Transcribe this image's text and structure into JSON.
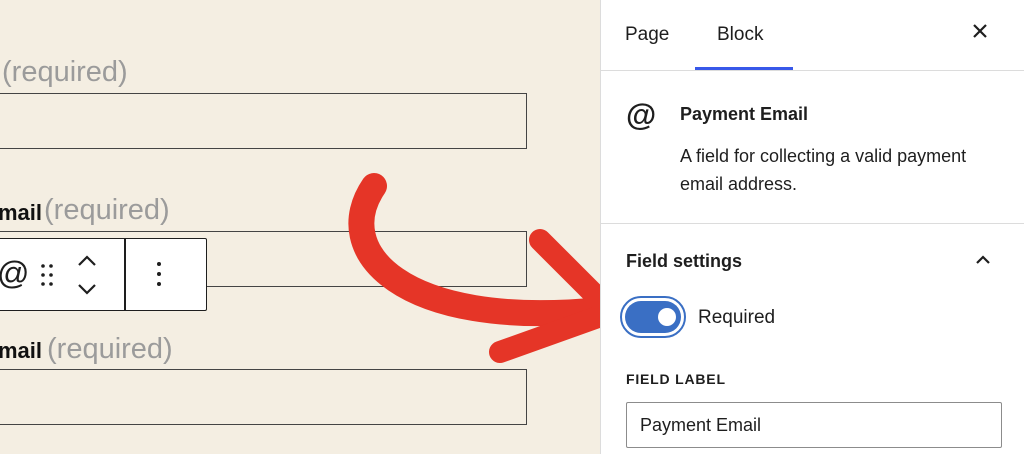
{
  "canvas": {
    "fields": [
      {
        "label": "",
        "required_text": "(required)"
      },
      {
        "label": "mail",
        "required_text": "(required)"
      },
      {
        "label": "mail",
        "required_text": "(required)"
      }
    ],
    "toolbar": {
      "block_icon": "at-sign-icon",
      "drag_icon": "drag-handle-icon",
      "mover_icon": "move-up-down-icon",
      "more_icon": "more-vertical-icon"
    },
    "annotation": {
      "arrow_color": "#e53527"
    }
  },
  "sidebar": {
    "tabs": [
      {
        "label": "Page",
        "active": false
      },
      {
        "label": "Block",
        "active": true
      }
    ],
    "close_icon": "close-icon",
    "block": {
      "icon": "at-sign-icon",
      "title": "Payment Email",
      "description": "A field for collecting a valid payment email address."
    },
    "field_settings": {
      "title": "Field settings",
      "expanded": true,
      "required_toggle": {
        "label": "Required",
        "checked": true
      },
      "field_label": {
        "title": "FIELD LABEL",
        "value": "Payment Email"
      }
    }
  },
  "colors": {
    "accent": "#3858e9",
    "toggle": "#3a6fc4",
    "canvas_bg": "#f4eee2"
  }
}
